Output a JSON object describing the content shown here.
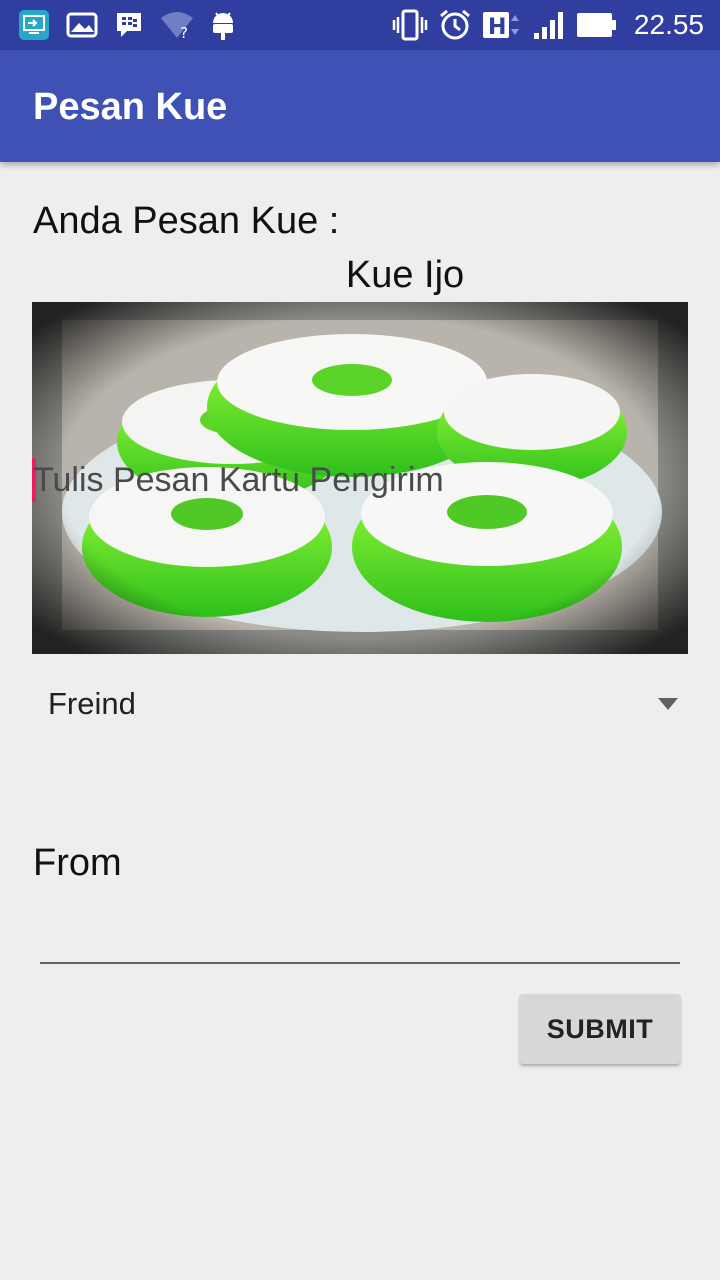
{
  "status_bar": {
    "time": "22.55",
    "network_type": "H",
    "left_icons": [
      "screen-mirror-icon",
      "gallery-icon",
      "bbm-icon",
      "wifi-question-icon",
      "android-debug-icon"
    ],
    "right_icons": [
      "vibrate-icon",
      "alarm-icon",
      "network-h-icon",
      "signal-icon",
      "battery-icon"
    ]
  },
  "app_bar": {
    "title": "Pesan Kue"
  },
  "order": {
    "label": "Anda Pesan Kue :",
    "cake_name": "Kue Ijo"
  },
  "message": {
    "placeholder": "Tulis Pesan Kartu Pengirim"
  },
  "spinner": {
    "selected": "Freind"
  },
  "from": {
    "label": "From",
    "value": ""
  },
  "submit": {
    "label": "SUBMIT"
  },
  "colors": {
    "status_bar": "#303f9f",
    "app_bar": "#3f51b5",
    "background": "#eeeeee",
    "cursor": "#e91e63",
    "button": "#d6d7d7"
  }
}
